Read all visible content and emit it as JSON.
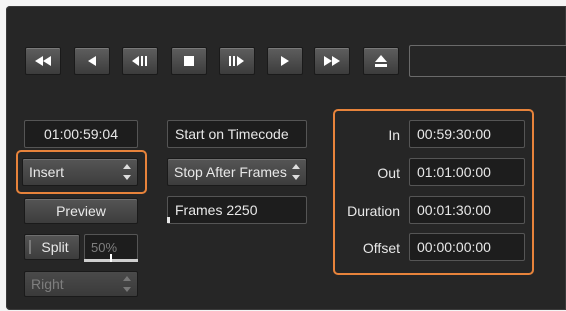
{
  "transport": {
    "buttons": [
      {
        "name": "rewind-fast-icon"
      },
      {
        "name": "rewind-icon"
      },
      {
        "name": "step-back-icon"
      },
      {
        "name": "stop-icon"
      },
      {
        "name": "step-forward-icon"
      },
      {
        "name": "play-icon"
      },
      {
        "name": "fast-forward-icon"
      },
      {
        "name": "eject-icon"
      }
    ]
  },
  "left": {
    "timecode": "01:00:59:04",
    "mode_select": "Insert",
    "preview_label": "Preview",
    "split_label": "Split",
    "split_percent": "50%",
    "split_level": 0.5,
    "channel_select": "Right"
  },
  "middle": {
    "start_label": "Start on Timecode",
    "stop_select": "Stop After Frames",
    "frames_value": "Frames 2250",
    "frames_progress": 0.02
  },
  "right": {
    "in_label": "In",
    "in_value": "00:59:30:00",
    "out_label": "Out",
    "out_value": "01:01:00:00",
    "duration_label": "Duration",
    "duration_value": "00:01:30:00",
    "offset_label": "Offset",
    "offset_value": "00:00:00:00"
  },
  "colors": {
    "highlight": "#e7833b",
    "panel": "#262626",
    "field": "#1d1d1d"
  }
}
